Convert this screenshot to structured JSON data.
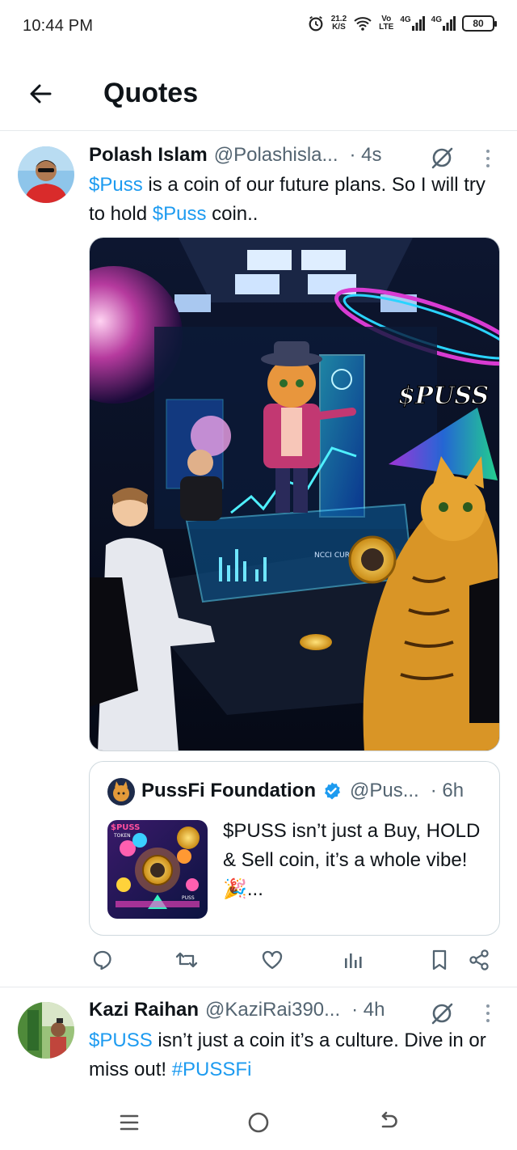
{
  "status_bar": {
    "time": "10:44 PM",
    "net_speed_value": "21.2",
    "net_speed_unit": "K/S",
    "volte_top": "Vo",
    "volte_bottom": "LTE",
    "sim1_label": "4G",
    "sim2_label": "4G",
    "battery": "80",
    "icons": [
      "alarm-icon",
      "wifi-icon",
      "signal-icon",
      "battery-icon"
    ]
  },
  "header": {
    "title": "Quotes",
    "back_icon": "arrow-left-icon"
  },
  "posts": [
    {
      "author": "Polash Islam",
      "handle": "@Polashisla...",
      "time": "· 4s",
      "text_parts": {
        "link1": "$Puss",
        "text1": " is a coin of our future plans. So I will try to hold ",
        "link2": "$Puss",
        "text2": " coin.."
      },
      "media_caption": "$PUSS",
      "media_labels": {
        "coin": "NCCI CURRIT"
      },
      "quoted": {
        "author": "PussFi Foundation",
        "handle": "@Pus...",
        "time": "· 6h",
        "text": "$PUSS isn’t just a Buy, HOLD & Sell coin, it’s a whole vibe! 🎉...",
        "thumb_labels": {
          "top": "$PUSS",
          "sub": "TOKEN",
          "side": "PUSS"
        }
      },
      "actions": [
        "reply-icon",
        "retweet-icon",
        "like-icon",
        "views-icon",
        "bookmark-icon",
        "share-icon"
      ]
    },
    {
      "author": "Kazi Raihan",
      "handle": "@KaziRai390...",
      "time": "· 4h",
      "text_parts": {
        "link1": "$PUSS",
        "text1": " isn’t just a coin it’s a culture. Dive in or miss out! ",
        "link2": "#PUSSFi"
      }
    }
  ],
  "colors": {
    "link": "#1d9bf0",
    "secondary_text": "#536471",
    "verified": "#1d9bf0",
    "divider": "#e6e9ec"
  },
  "bottom_nav": [
    "menu-icon",
    "home-icon",
    "back-icon"
  ]
}
